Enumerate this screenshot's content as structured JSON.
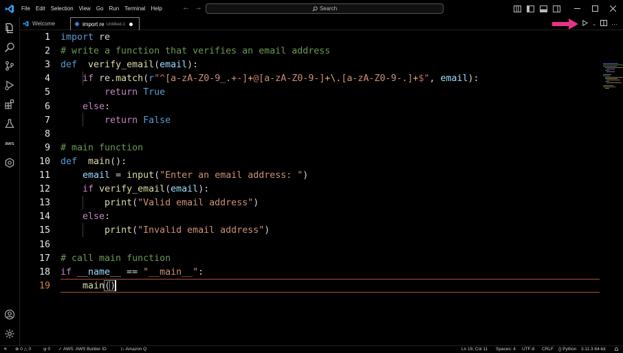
{
  "menu": [
    "File",
    "Edit",
    "Selection",
    "View",
    "Go",
    "Run",
    "Terminal",
    "Help"
  ],
  "search": {
    "label": "Search"
  },
  "tabs": [
    {
      "label": "Welcome",
      "icon": "vscode-logo-icon"
    },
    {
      "label": "import re",
      "sublabel": "Untitled-1",
      "icon": "python-file-icon",
      "dirty": true
    }
  ],
  "editor": {
    "lines": [
      {
        "n": "1",
        "tokens": [
          [
            "kw",
            "import"
          ],
          [
            "plain",
            " re"
          ]
        ]
      },
      {
        "n": "2",
        "tokens": [
          [
            "cmt",
            "# write a function that verifies an email address"
          ]
        ]
      },
      {
        "n": "3",
        "tokens": [
          [
            "kw",
            "def"
          ],
          [
            "plain",
            "  "
          ],
          [
            "fn",
            "verify_email"
          ],
          [
            "plain",
            "("
          ],
          [
            "var",
            "email"
          ],
          [
            "plain",
            "):"
          ]
        ]
      },
      {
        "n": "4",
        "tokens": [
          [
            "plain",
            "    "
          ],
          [
            "ctrl",
            "if"
          ],
          [
            "plain",
            " re."
          ],
          [
            "fn",
            "match"
          ],
          [
            "plain",
            "("
          ],
          [
            "kw",
            "r"
          ],
          [
            "re",
            "\"^"
          ],
          [
            "regc",
            "[a-zA-Z0-9_.+-]"
          ],
          [
            "regesc",
            "+"
          ],
          [
            "re",
            "@"
          ],
          [
            "regc",
            "[a-zA-Z0-9-]"
          ],
          [
            "regesc",
            "+"
          ],
          [
            "regesc",
            "\\."
          ],
          [
            "regc",
            "[a-zA-Z0-9-.]"
          ],
          [
            "regesc",
            "+"
          ],
          [
            "re",
            "$\""
          ],
          [
            "plain",
            ", "
          ],
          [
            "var",
            "email"
          ],
          [
            "plain",
            "):"
          ]
        ]
      },
      {
        "n": "5",
        "tokens": [
          [
            "plain",
            "        "
          ],
          [
            "ctrl",
            "return"
          ],
          [
            "plain",
            " "
          ],
          [
            "kw",
            "True"
          ]
        ]
      },
      {
        "n": "6",
        "tokens": [
          [
            "plain",
            "    "
          ],
          [
            "ctrl",
            "else"
          ],
          [
            "plain",
            ":"
          ]
        ]
      },
      {
        "n": "7",
        "tokens": [
          [
            "plain",
            "        "
          ],
          [
            "ctrl",
            "return"
          ],
          [
            "plain",
            " "
          ],
          [
            "kw",
            "False"
          ]
        ]
      },
      {
        "n": "8",
        "tokens": []
      },
      {
        "n": "9",
        "tokens": [
          [
            "cmt",
            "# main function"
          ]
        ]
      },
      {
        "n": "10",
        "tokens": [
          [
            "kw",
            "def"
          ],
          [
            "plain",
            "  "
          ],
          [
            "fn",
            "main"
          ],
          [
            "plain",
            "():"
          ]
        ]
      },
      {
        "n": "11",
        "tokens": [
          [
            "plain",
            "    "
          ],
          [
            "var",
            "email"
          ],
          [
            "plain",
            " = "
          ],
          [
            "fn",
            "input"
          ],
          [
            "plain",
            "("
          ],
          [
            "str",
            "\"Enter an email address: \""
          ],
          [
            "plain",
            ")"
          ]
        ]
      },
      {
        "n": "12",
        "tokens": [
          [
            "plain",
            "    "
          ],
          [
            "ctrl",
            "if"
          ],
          [
            "plain",
            " "
          ],
          [
            "fn",
            "verify_email"
          ],
          [
            "plain",
            "("
          ],
          [
            "var",
            "email"
          ],
          [
            "plain",
            "):"
          ]
        ]
      },
      {
        "n": "13",
        "tokens": [
          [
            "plain",
            "        "
          ],
          [
            "fn",
            "print"
          ],
          [
            "plain",
            "("
          ],
          [
            "str",
            "\"Valid email address\""
          ],
          [
            "plain",
            ")"
          ]
        ]
      },
      {
        "n": "14",
        "tokens": [
          [
            "plain",
            "    "
          ],
          [
            "ctrl",
            "else"
          ],
          [
            "plain",
            ":"
          ]
        ]
      },
      {
        "n": "15",
        "tokens": [
          [
            "plain",
            "        "
          ],
          [
            "fn",
            "print"
          ],
          [
            "plain",
            "("
          ],
          [
            "str",
            "\"Invalid email address\""
          ],
          [
            "plain",
            ")"
          ]
        ]
      },
      {
        "n": "16",
        "tokens": []
      },
      {
        "n": "17",
        "tokens": [
          [
            "cmt",
            "# call main function"
          ]
        ]
      },
      {
        "n": "18",
        "tokens": [
          [
            "ctrl",
            "if"
          ],
          [
            "plain",
            " "
          ],
          [
            "var",
            "__name__"
          ],
          [
            "plain",
            " == "
          ],
          [
            "str",
            "\"__main__\""
          ],
          [
            "plain",
            ":"
          ]
        ]
      },
      {
        "n": "19",
        "tokens": [
          [
            "plain",
            "    "
          ],
          [
            "fn",
            "main"
          ],
          [
            "plain",
            "()"
          ]
        ]
      }
    ]
  },
  "status": {
    "errors": "0",
    "warnings": "0",
    "ports": "0",
    "aws": "AWS: AWS Builder ID",
    "amazon_q": "Amazon Q",
    "cursor_pos": "Ln 19, Col 11",
    "spaces": "Spaces: 4",
    "encoding": "UTF-8",
    "eol": "CRLF",
    "language": "Python",
    "interpreter": "3.11.3 64-bit"
  },
  "colors": {
    "current_line_border": "#b0522d",
    "highlight_arrow": "#e8338a"
  }
}
